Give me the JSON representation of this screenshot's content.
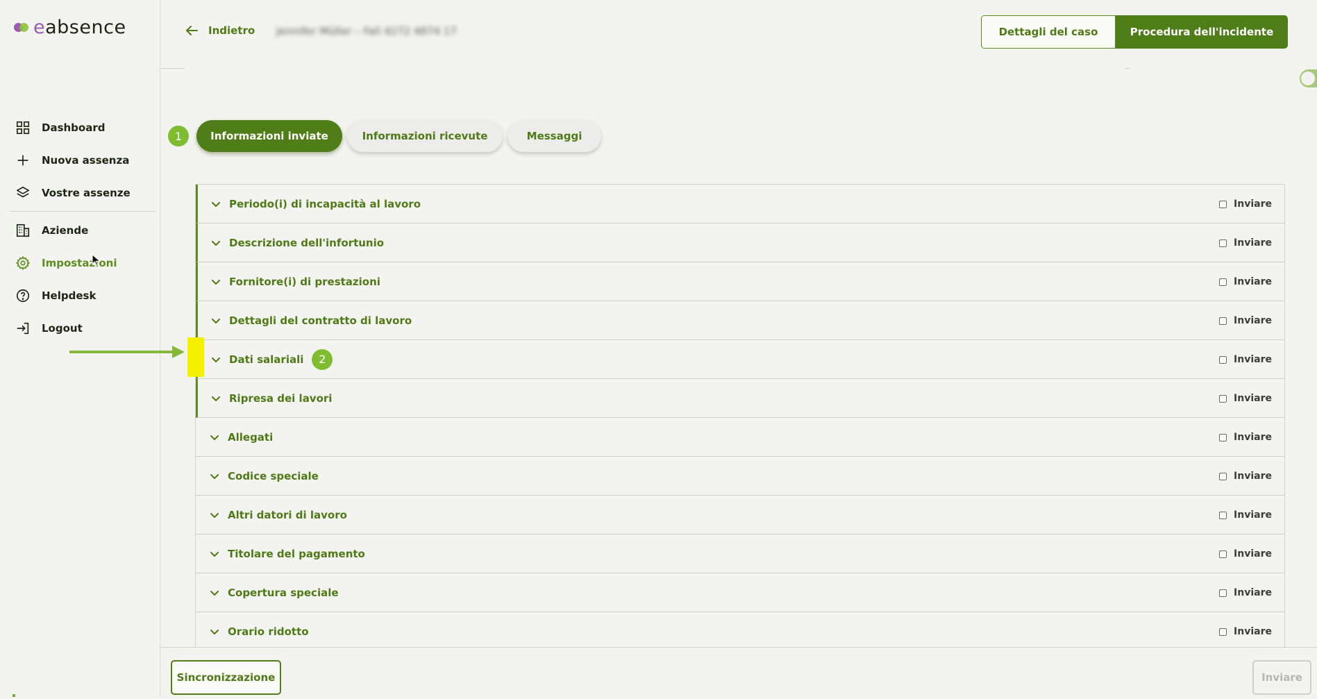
{
  "brand": {
    "logo_prefix": "e",
    "logo_rest": "absence"
  },
  "sidebar": {
    "items": [
      {
        "label": "Dashboard",
        "icon": "grid-icon"
      },
      {
        "label": "Nuova assenza",
        "icon": "plus-icon"
      },
      {
        "label": "Vostre assenze",
        "icon": "layers-icon"
      },
      {
        "label": "Aziende",
        "icon": "building-icon"
      },
      {
        "label": "Impostazioni",
        "icon": "gear-icon",
        "active": true
      },
      {
        "label": "Helpdesk",
        "icon": "help-circle-icon"
      },
      {
        "label": "Logout",
        "icon": "logout-icon"
      }
    ]
  },
  "header": {
    "back_label": "Indietro",
    "case_title": "Jennifer Müller – Fall 4272 4874 17",
    "btn_case_details": "Dettagli del caso",
    "btn_incident_procedure": "Procedura dell'incidente"
  },
  "tabs": {
    "step_badge": "1",
    "items": [
      {
        "label": "Informazioni inviate",
        "active": true
      },
      {
        "label": "Informazioni ricevute",
        "active": false
      },
      {
        "label": "Messaggi",
        "active": false
      }
    ]
  },
  "sections": {
    "send_label": "Inviare",
    "rows": [
      {
        "label": "Periodo(i) di incapacità al lavoro",
        "marked": true
      },
      {
        "label": "Descrizione dell'infortunio",
        "marked": true
      },
      {
        "label": "Fornitore(i) di prestazioni",
        "marked": true
      },
      {
        "label": "Dettagli del contratto di lavoro",
        "marked": true
      },
      {
        "label": "Dati salariali",
        "marked": true,
        "badge": "2"
      },
      {
        "label": "Ripresa dei lavori",
        "marked": true
      },
      {
        "label": "Allegati",
        "marked": false
      },
      {
        "label": "Codice speciale",
        "marked": false
      },
      {
        "label": "Altri datori di lavoro",
        "marked": false
      },
      {
        "label": "Titolare del pagamento",
        "marked": false
      },
      {
        "label": "Copertura speciale",
        "marked": false
      },
      {
        "label": "Orario ridotto",
        "marked": false
      }
    ]
  },
  "footer": {
    "btn_sync": "Sincronizzazione",
    "btn_send": "Inviare"
  },
  "colors": {
    "accent": "#4f7d17",
    "accent_text": "#4f7a17",
    "badge": "#7fbc32",
    "highlight": "#f3f000",
    "background": "#f3f3ef"
  }
}
